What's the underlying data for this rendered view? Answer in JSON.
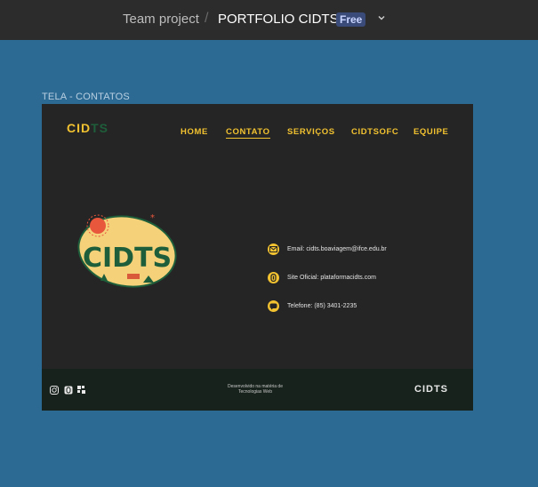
{
  "topbar": {
    "team": "Team project",
    "separator": "/",
    "file": "PORTFOLIO CIDTS",
    "plan_badge": "Free",
    "menu_icon": "chevron-down-icon"
  },
  "frame": {
    "label": "TELA - CONTATOS",
    "logo_part1": "CID",
    "logo_part2": "TS",
    "nav": [
      {
        "label": "HOME"
      },
      {
        "label": "CONTATO"
      },
      {
        "label": "SERVIÇOS"
      },
      {
        "label": "CIDTSOFC"
      },
      {
        "label": "EQUIPE"
      }
    ],
    "illustration_text": "CIDTS",
    "contacts": [
      {
        "text": "Email: cidts.boaviagem@ifce.edu.br",
        "icon": "mail-icon"
      },
      {
        "text": "Site Oficial: plataformacidts.com",
        "icon": "link-icon"
      },
      {
        "text": "Telefone: (85) 3401-2235",
        "icon": "chat-icon"
      }
    ],
    "footer": {
      "note_line1": "Desenvolvido na matéria de",
      "note_line2": "Tecnologias Web",
      "brand": "CIDTS",
      "social_icons": [
        "instagram-icon",
        "link-icon",
        "grid-icon"
      ]
    }
  },
  "colors": {
    "canvas": "#2c6a94",
    "topbar": "#2c2c2c",
    "frame_bg": "#252525",
    "accent": "#f2c230",
    "green": "#1e5e3a",
    "footer_bg": "#17221c"
  }
}
